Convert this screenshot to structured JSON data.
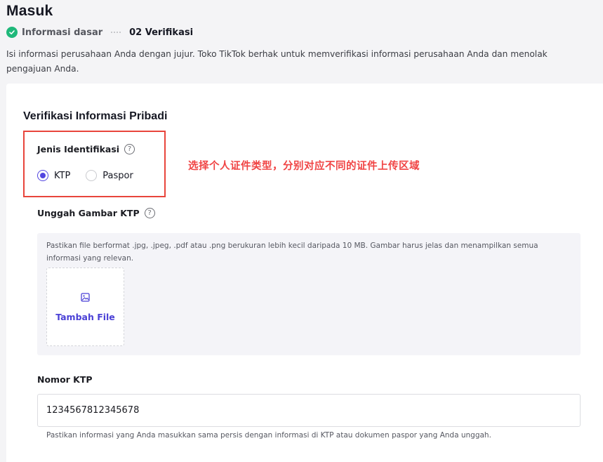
{
  "page": {
    "title": "Masuk"
  },
  "steps": [
    {
      "label": "Informasi dasar",
      "status": "done"
    },
    {
      "label": "02 Verifikasi",
      "status": "current"
    }
  ],
  "intro": "Isi informasi perusahaan Anda dengan jujur. Toko TikTok berhak untuk memverifikasi informasi perusahaan Anda dan menolak pengajuan Anda.",
  "card": {
    "title": "Verifikasi Informasi Pribadi",
    "annotation": "选择个人证件类型，分别对应不同的证件上传区域",
    "id_type": {
      "label": "Jenis Identifikasi",
      "options": [
        "KTP",
        "Paspor"
      ],
      "selected": "KTP"
    },
    "upload": {
      "label": "Unggah Gambar KTP",
      "hint": "Pastikan file berformat .jpg, .jpeg, .pdf atau .png berukuran lebih kecil daripada 10 MB. Gambar harus jelas dan menampilkan semua informasi yang relevan.",
      "add_label": "Tambah File"
    },
    "ktp_number": {
      "label": "Nomor KTP",
      "value": "1234567812345678",
      "hint": "Pastikan informasi yang Anda masukkan sama persis dengan informasi di KTP atau dokumen paspor yang Anda unggah."
    }
  },
  "colors": {
    "accent": "#5245e0",
    "success": "#1fb87a",
    "annotation": "#f04444",
    "upload_bg": "#f4f4f8"
  },
  "icons": [
    "check-circle-icon",
    "help-icon",
    "image-icon"
  ]
}
